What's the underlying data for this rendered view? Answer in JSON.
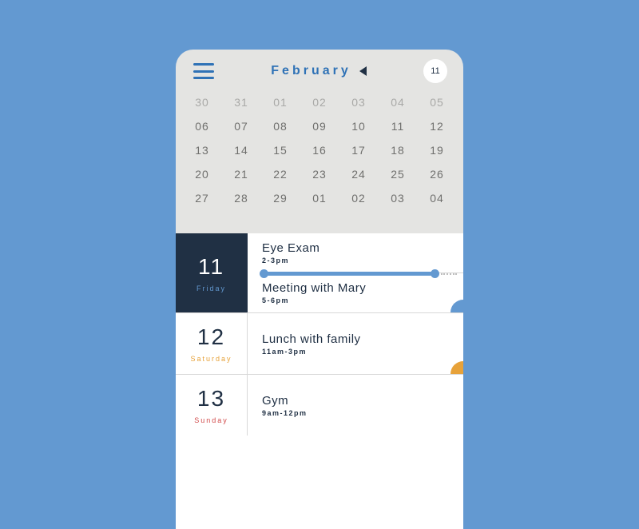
{
  "header": {
    "month": "February",
    "today_badge": "11"
  },
  "calendar": {
    "rows": [
      [
        "30",
        "31",
        "01",
        "02",
        "03",
        "04",
        "05"
      ],
      [
        "06",
        "07",
        "08",
        "09",
        "10",
        "11",
        "12"
      ],
      [
        "13",
        "14",
        "15",
        "16",
        "17",
        "18",
        "19"
      ],
      [
        "20",
        "21",
        "22",
        "23",
        "24",
        "25",
        "26"
      ],
      [
        "27",
        "28",
        "29",
        "01",
        "02",
        "03",
        "04"
      ]
    ]
  },
  "agenda": [
    {
      "num": "11",
      "name": "Friday",
      "selected": true,
      "name_class": "",
      "events": [
        {
          "title": "Eye Exam",
          "time": "2-3pm"
        },
        {
          "title": "Meeting with Mary",
          "time": "5-6pm"
        }
      ],
      "progress_between_events": true,
      "quarter_color": "blue"
    },
    {
      "num": "12",
      "name": "Saturday",
      "selected": false,
      "name_class": "sat",
      "events": [
        {
          "title": "Lunch with family",
          "time": "11am-3pm"
        }
      ],
      "quarter_color": "yellow"
    },
    {
      "num": "13",
      "name": "Sunday",
      "selected": false,
      "name_class": "sun",
      "events": [
        {
          "title": "Gym",
          "time": "9am-12pm"
        }
      ],
      "quarter_color": ""
    }
  ],
  "progress": {
    "bar_width_pct": 86,
    "dashed_start_pct": 89,
    "dashed_width_pct": 8
  },
  "colors": {
    "background": "#6399d1",
    "phone_bg": "#e4e4e2",
    "accent": "#2f72b6",
    "dark": "#203044",
    "sat": "#e7a23a",
    "sun": "#d14b4b"
  }
}
